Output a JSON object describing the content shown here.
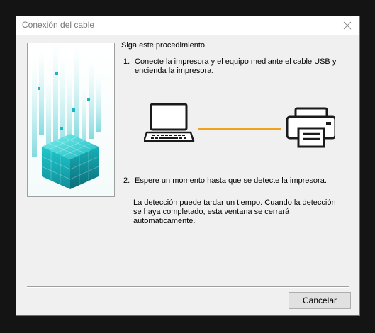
{
  "window": {
    "title": "Conexión del cable"
  },
  "content": {
    "intro": "Siga este procedimiento.",
    "step1_number": "1.",
    "step1_text": "Conecte la impresora y el equipo mediante el cable USB y encienda la impresora.",
    "step2_number": "2.",
    "step2_text": "Espere un momento hasta que se detecte la impresora.",
    "note": "La detección puede tardar un tiempo. Cuando la detección se haya completado, esta ventana se cerrará automáticamente."
  },
  "buttons": {
    "cancel_label": "Cancelar"
  },
  "icons": {
    "close": "close-icon",
    "laptop": "laptop-icon",
    "printer": "printer-icon"
  },
  "colors": {
    "cable": "#f0a21e",
    "accent_cyan": "#19c6c6"
  }
}
